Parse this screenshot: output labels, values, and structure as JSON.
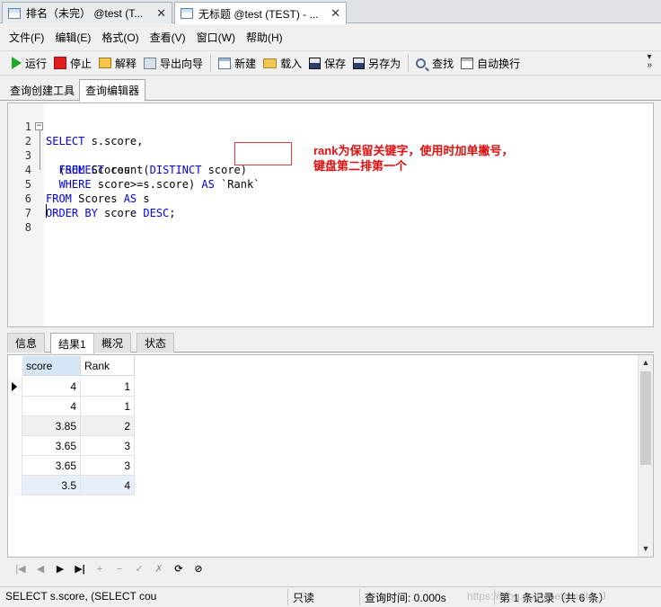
{
  "window_tabs": [
    {
      "title": "排名（未完） @test (T..."
    },
    {
      "title": "无标题 @test (TEST) - ..."
    }
  ],
  "menu": [
    "文件(F)",
    "编辑(E)",
    "格式(O)",
    "查看(V)",
    "窗口(W)",
    "帮助(H)"
  ],
  "toolbar": {
    "run": "运行",
    "stop": "停止",
    "explain": "解释",
    "export": "导出向导",
    "new": "新建",
    "load": "载入",
    "save": "保存",
    "saveas": "另存为",
    "find": "查找",
    "wrap": "自动换行"
  },
  "sub_tabs": [
    "查询创建工具",
    "查询编辑器"
  ],
  "editor": {
    "line_numbers": [
      "1",
      "2",
      "3",
      "4",
      "5",
      "6",
      "7",
      "8"
    ],
    "l1_kw": "SELECT",
    "l1_rest": " s.score,",
    "l2_pre": "  (",
    "l2_kw": "SELECT",
    "l2_mid": " count(",
    "l2_kw2": "DISTINCT",
    "l2_rest": " score)",
    "l3_pre": "  ",
    "l3_kw": "FROM",
    "l3_rest": " Scores",
    "l4_pre": "  ",
    "l4_kw": "WHERE",
    "l4_mid": " score>=s.score) ",
    "l4_kw2": "AS",
    "l4_rest": " `Rank`",
    "l5_kw": "FROM",
    "l5_mid": " Scores ",
    "l5_kw2": "AS",
    "l5_rest": " s",
    "l6_kw": "ORDER BY",
    "l6_mid": " score ",
    "l6_kw2": "DESC",
    "l6_rest": ";",
    "fold_marker": "⊟"
  },
  "annotation": {
    "line1": "rank为保留关键字，使用时加单撇号，",
    "line2": "键盘第二排第一个"
  },
  "result_tabs": [
    "信息",
    "结果1",
    "概况",
    "状态"
  ],
  "result": {
    "columns": [
      "score",
      "Rank"
    ],
    "rows": [
      {
        "score": "4",
        "rank": "1"
      },
      {
        "score": "4",
        "rank": "1"
      },
      {
        "score": "3.85",
        "rank": "2"
      },
      {
        "score": "3.65",
        "rank": "3"
      },
      {
        "score": "3.65",
        "rank": "3"
      },
      {
        "score": "3.5",
        "rank": "4"
      }
    ]
  },
  "nav_buttons": [
    "|◀",
    "◀",
    "▶",
    "▶|",
    "+",
    "−",
    "✓",
    "✗",
    "⟳",
    "⊘"
  ],
  "status": {
    "sql": "SELECT s.score,    (SELECT cou",
    "mode": "只读",
    "time": "查询时间: 0.000s",
    "records": "第 1 条记录（共 6 条）"
  },
  "watermark": "https://blog.csdn.net/misite_J"
}
